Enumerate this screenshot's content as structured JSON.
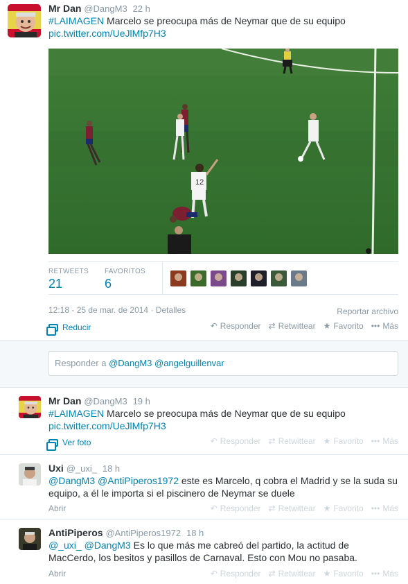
{
  "main_tweet": {
    "name": "Mr Dan",
    "handle": "@DangM3",
    "time": "22 h",
    "hashtag": "#LAIMAGEN",
    "text": " Marcelo se preocupa más de Neymar que de su equipo",
    "link": "pic.twitter.com/UeJlMfp7H3",
    "stats": {
      "retweets_label": "RETWEETS",
      "retweets_count": "21",
      "favorites_label": "FAVORITOS",
      "favorites_count": "6"
    },
    "timestamp": "12:18 - 25 de mar. de 2014",
    "details_label": "Detalles",
    "report_label": "Reportar archivo",
    "collapse_label": "Reducir",
    "actions": {
      "reply": "Responder",
      "retweet": "Retwittear",
      "favorite": "Favorito",
      "more": "Más"
    },
    "reply_box_prefix": "Responder a ",
    "reply_box_mentions": "@DangM3 @angelguillenvar",
    "favoriter_colors": [
      "#8a3a1f",
      "#3c6a2a",
      "#7a4a8a",
      "#2a3f2a",
      "#1f1f2a",
      "#3a5a3a",
      "#6a7a8a"
    ]
  },
  "retweet_item": {
    "name": "Mr Dan",
    "handle": "@DangM3",
    "time": "19 h",
    "hashtag": "#LAIMAGEN",
    "text": " Marcelo se preocupa más de Neymar que de su equipo",
    "link": "pic.twitter.com/UeJlMfp7H3",
    "expand_label": "Ver foto"
  },
  "reply1": {
    "name": "Uxi",
    "handle": "@_uxi_",
    "time": "18 h",
    "mention1": "@DangM3",
    "mention2": " @AntiPiperos1972",
    "text": " este es Marcelo, q cobra el Madrid y se la suda su equipo, a él le importa si el piscinero de Neymar se duele",
    "open_label": "Abrir"
  },
  "reply2": {
    "name": "AntiPiperos",
    "handle": "@AntiPiperos1972",
    "time": "18 h",
    "mention1": "@_uxi_",
    "mention2": " @DangM3",
    "text": " Es lo que más me cabreó del partido, la actitud de MacCerdo, los besitos y pasillos de Carnaval. Esto con Mou no pasaba.",
    "open_label": "Abrir"
  },
  "colors": {
    "link": "#0084b4",
    "muted": "#8899a6",
    "pitch": "#3d7a35"
  }
}
